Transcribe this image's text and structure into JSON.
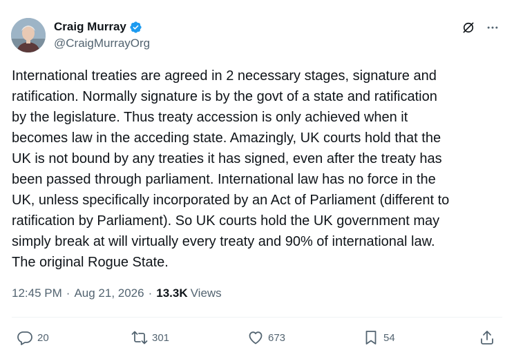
{
  "author": {
    "display_name": "Craig Murray",
    "handle": "@CraigMurrayOrg"
  },
  "tweet": {
    "text": "International treaties are agreed in 2 necessary stages, signature and\nratification. Normally signature is by the govt of a state and ratification\nby the legislature. Thus treaty accession is only achieved when it\nbecomes law in the acceding state. Amazingly, UK courts hold that the\nUK is not bound by any treaties it has signed, even after the treaty has\nbeen passed through parliament. International law has no force in the\nUK, unless specifically incorporated by an Act of Parliament (different to\nratification by Parliament). So UK courts hold the UK government may\nsimply break at will virtually every treaty and 90% of international law.\nThe original Rogue State."
  },
  "meta": {
    "time": "12:45 PM",
    "separator": "·",
    "date": "Aug 21, 2026",
    "views_count": "13.3K",
    "views_label": "Views"
  },
  "actions": {
    "replies": "20",
    "reposts": "301",
    "likes": "673",
    "bookmarks": "54"
  },
  "colors": {
    "verified": "#1d9bf0",
    "text": "#0f1419",
    "secondary": "#536471"
  }
}
